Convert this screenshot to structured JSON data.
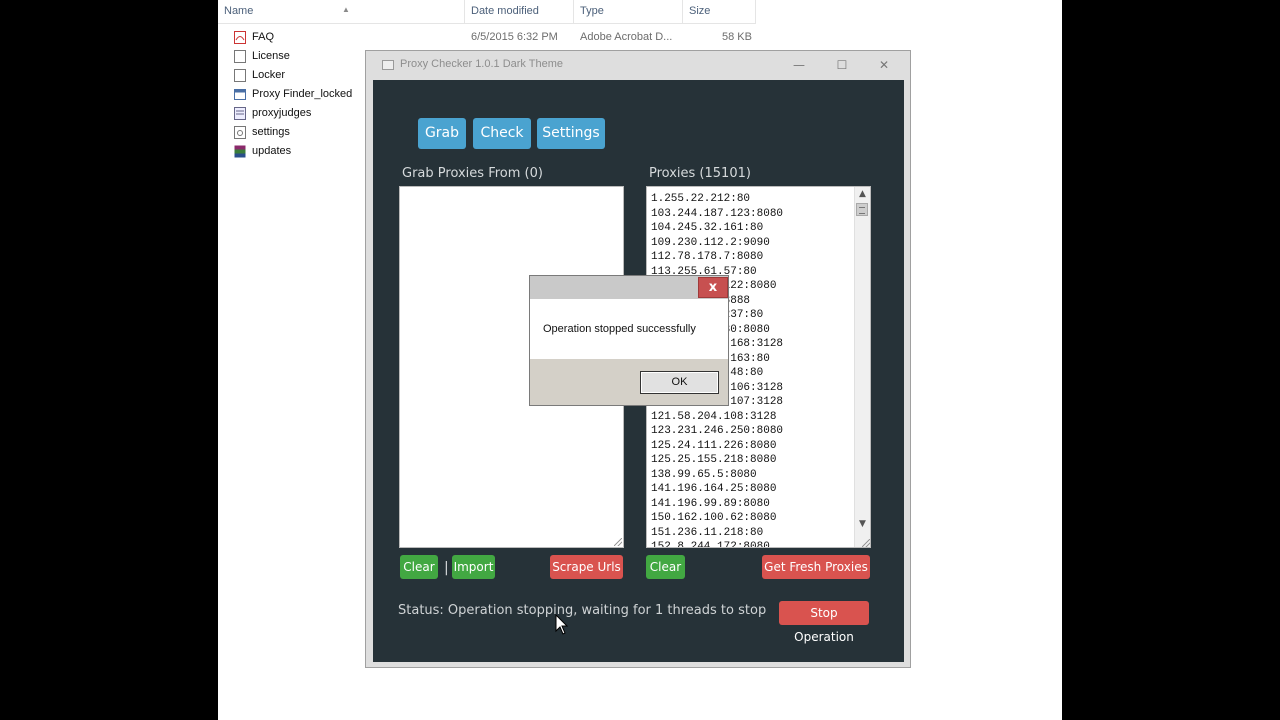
{
  "explorer": {
    "columns": {
      "name": "Name",
      "date": "Date modified",
      "type": "Type",
      "size": "Size"
    },
    "files": [
      {
        "name": "FAQ",
        "date": "6/5/2015 6:32 PM",
        "type": "Adobe Acrobat D...",
        "size": "58 KB",
        "icon": "pdf-icon"
      },
      {
        "name": "License",
        "date": "",
        "type": "",
        "size": "",
        "icon": "text-file-icon"
      },
      {
        "name": "Locker",
        "date": "",
        "type": "",
        "size": "",
        "icon": "text-file-icon"
      },
      {
        "name": "Proxy Finder_locked",
        "date": "",
        "type": "",
        "size": "",
        "icon": "app-window-icon"
      },
      {
        "name": "proxyjudges",
        "date": "",
        "type": "",
        "size": "",
        "icon": "config-file-icon"
      },
      {
        "name": "settings",
        "date": "",
        "type": "",
        "size": "",
        "icon": "settings-file-icon"
      },
      {
        "name": "updates",
        "date": "",
        "type": "",
        "size": "",
        "icon": "archive-icon"
      }
    ]
  },
  "app": {
    "title": "Proxy Checker 1.0.1 Dark Theme",
    "window_controls": {
      "minimize": "—",
      "maximize": "☐",
      "close": "✕"
    },
    "nav": {
      "grab": "Grab",
      "check": "Check",
      "settings": "Settings"
    },
    "left_panel": {
      "label": "Grab Proxies From (0)",
      "clear": "Clear",
      "separator": "|",
      "import": "Import",
      "scrape": "Scrape Urls"
    },
    "right_panel": {
      "label": "Proxies (15101)",
      "clear": "Clear",
      "fresh": "Get Fresh Proxies",
      "proxies": [
        "1.255.22.212:80",
        "103.244.187.123:8080",
        "104.245.32.161:80",
        "109.230.112.2:9090",
        "112.78.178.7:8080",
        "113.255.61.57:80",
        "118.97.191.122:8080",
        "118.97.5.3:8888",
        "119.46.110.237:80",
        "119.110.69.30:8080",
        "120.198.236.168:3128",
        "120.198.243.163:80",
        "120.202.249.48:80",
        "120.203.159.106:3128",
        "120.203.159.107:3128",
        "121.58.204.108:3128",
        "123.231.246.250:8080",
        "125.24.111.226:8080",
        "125.25.155.218:8080",
        "138.99.65.5:8080",
        "141.196.164.25:8080",
        "141.196.99.89:8080",
        "150.162.100.62:8080",
        "151.236.11.218:80",
        "152.8.244.172:8080"
      ]
    },
    "status": "Status: Operation stopping, waiting for 1 threads to stop",
    "stop": "Stop Operation"
  },
  "dialog": {
    "close": "x",
    "message": "Operation stopped successfully",
    "ok": "OK"
  },
  "colors": {
    "app_bg": "#263238",
    "accent_blue": "#4aa3d0",
    "accent_green": "#42a842",
    "accent_red": "#d9534f"
  }
}
